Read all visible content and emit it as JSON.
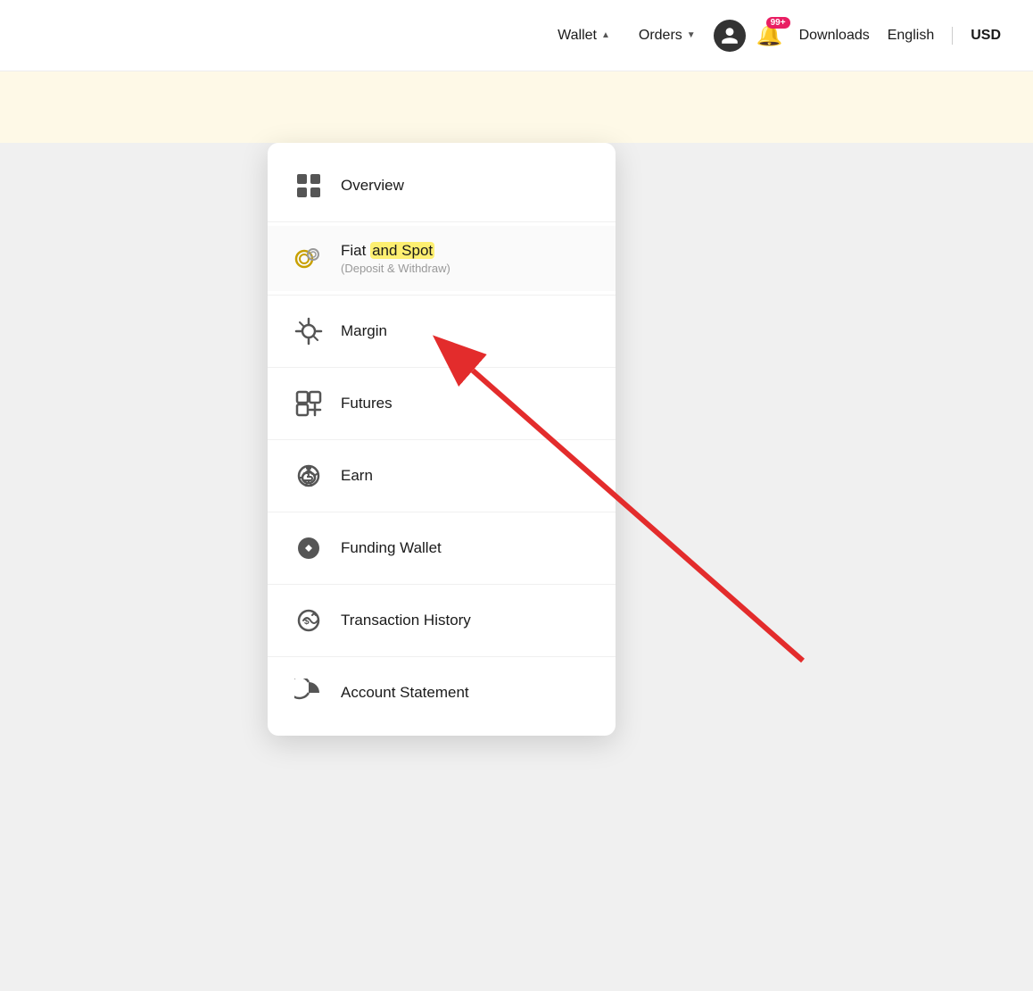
{
  "navbar": {
    "wallet_label": "Wallet",
    "orders_label": "Orders",
    "downloads_label": "Downloads",
    "english_label": "English",
    "usd_label": "USD",
    "notification_badge": "99+",
    "wallet_caret": "▲",
    "orders_caret": "▼"
  },
  "dropdown": {
    "items": [
      {
        "id": "overview",
        "label": "Overview",
        "sublabel": "",
        "icon": "overview-icon"
      },
      {
        "id": "fiat-spot",
        "label": "Fiat and Spot",
        "sublabel": "(Deposit & Withdraw)",
        "icon": "fiat-spot-icon"
      },
      {
        "id": "margin",
        "label": "Margin",
        "sublabel": "",
        "icon": "margin-icon"
      },
      {
        "id": "futures",
        "label": "Futures",
        "sublabel": "",
        "icon": "futures-icon"
      },
      {
        "id": "earn",
        "label": "Earn",
        "sublabel": "",
        "icon": "earn-icon"
      },
      {
        "id": "funding-wallet",
        "label": "Funding Wallet",
        "sublabel": "",
        "icon": "funding-wallet-icon"
      },
      {
        "id": "transaction-history",
        "label": "Transaction History",
        "sublabel": "",
        "icon": "transaction-history-icon"
      },
      {
        "id": "account-statement",
        "label": "Account Statement",
        "sublabel": "",
        "icon": "account-statement-icon"
      }
    ]
  }
}
